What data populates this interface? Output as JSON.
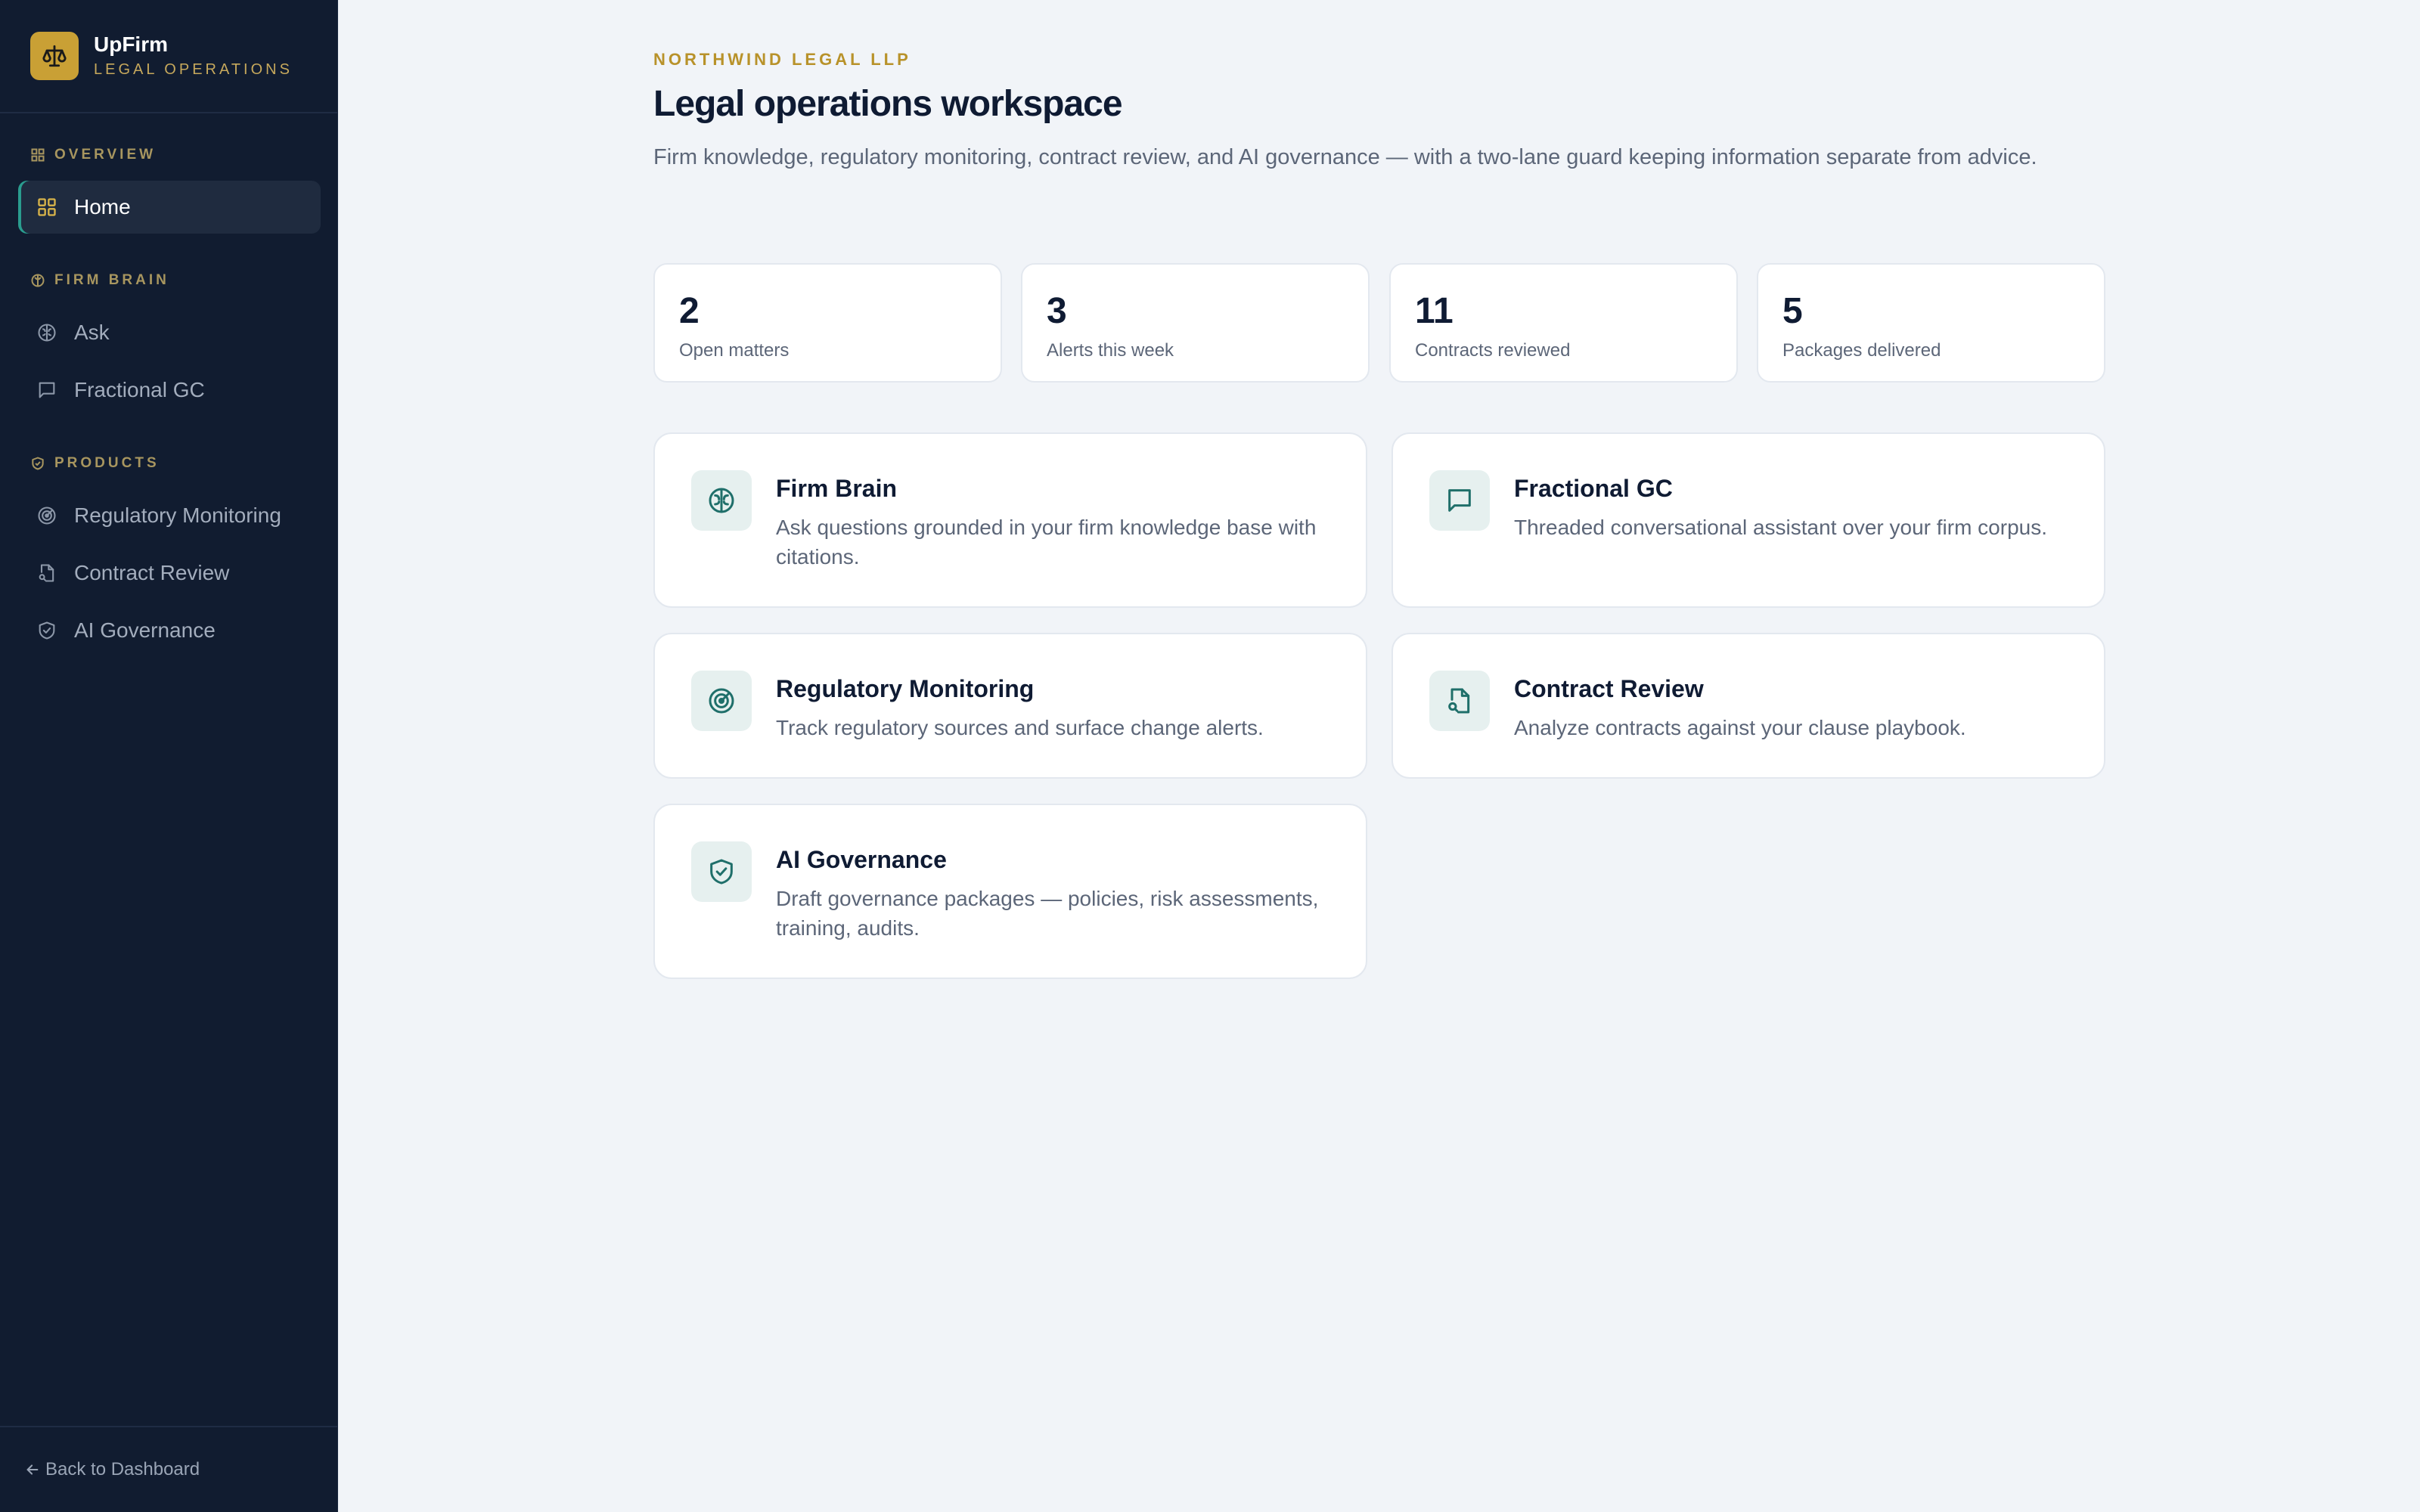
{
  "brand": {
    "name": "UpFirm",
    "subtitle": "LEGAL OPERATIONS",
    "logo_icon": "scale-icon",
    "accent": "#c9a035"
  },
  "sidebar": {
    "sections": [
      {
        "label": "OVERVIEW",
        "icon": "grid-icon",
        "items": [
          {
            "label": "Home",
            "icon": "grid-icon",
            "active": true
          }
        ]
      },
      {
        "label": "FIRM BRAIN",
        "icon": "brain-icon",
        "items": [
          {
            "label": "Ask",
            "icon": "brain-icon",
            "active": false
          },
          {
            "label": "Fractional GC",
            "icon": "chat-bubble-icon",
            "active": false
          }
        ]
      },
      {
        "label": "PRODUCTS",
        "icon": "shield-check-icon",
        "items": [
          {
            "label": "Regulatory Monitoring",
            "icon": "radar-icon",
            "active": false
          },
          {
            "label": "Contract Review",
            "icon": "file-search-icon",
            "active": false
          },
          {
            "label": "AI Governance",
            "icon": "shield-check-icon",
            "active": false
          }
        ]
      }
    ],
    "footer": {
      "back_label": "Back to Dashboard",
      "icon": "arrow-left-icon"
    }
  },
  "main": {
    "eyebrow": "NORTHWIND LEGAL LLP",
    "title": "Legal operations workspace",
    "description": "Firm knowledge, regulatory monitoring, contract review, and AI governance — with a two-lane guard keeping information separate from advice.",
    "stats": [
      {
        "value": "2",
        "label": "Open matters"
      },
      {
        "value": "3",
        "label": "Alerts this week"
      },
      {
        "value": "11",
        "label": "Contracts reviewed"
      },
      {
        "value": "5",
        "label": "Packages delivered"
      }
    ],
    "features": [
      {
        "title": "Firm Brain",
        "description": "Ask questions grounded in your firm knowledge base with citations.",
        "icon": "brain-icon"
      },
      {
        "title": "Fractional GC",
        "description": "Threaded conversational assistant over your firm corpus.",
        "icon": "chat-bubble-icon"
      },
      {
        "title": "Regulatory Monitoring",
        "description": "Track regulatory sources and surface change alerts.",
        "icon": "radar-icon"
      },
      {
        "title": "Contract Review",
        "description": "Analyze contracts against your clause playbook.",
        "icon": "file-search-icon"
      },
      {
        "title": "AI Governance",
        "description": "Draft governance packages — policies, risk assessments, training, audits.",
        "icon": "shield-check-icon"
      }
    ]
  },
  "colors": {
    "sidebar_bg": "#111c30",
    "page_bg": "#f1f4f8",
    "icon_teal": "#1f6f6a",
    "gold": "#b8922a"
  }
}
